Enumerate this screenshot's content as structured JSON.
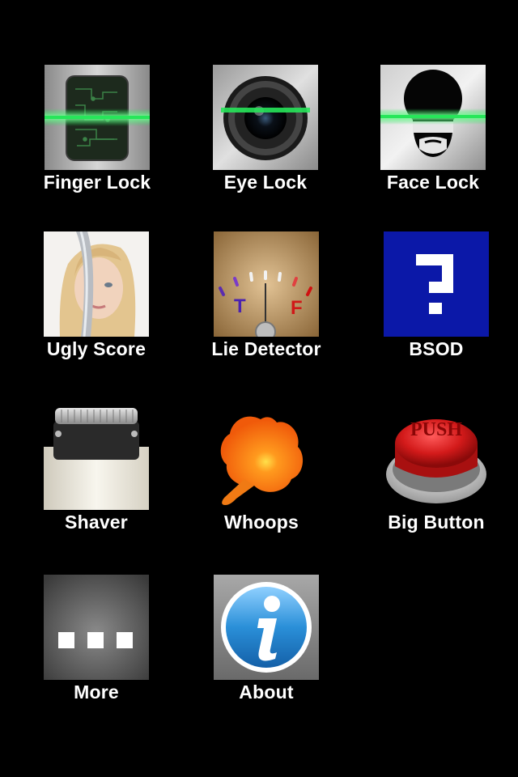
{
  "apps": [
    {
      "label": "Finger Lock",
      "icon": "fingerprint-scanner-icon"
    },
    {
      "label": "Eye Lock",
      "icon": "camera-lens-icon"
    },
    {
      "label": "Face Lock",
      "icon": "face-scan-icon"
    },
    {
      "label": "Ugly Score",
      "icon": "face-photo-icon"
    },
    {
      "label": "Lie Detector",
      "icon": "gauge-meter-icon"
    },
    {
      "label": "BSOD",
      "icon": "question-mark-icon"
    },
    {
      "label": "Shaver",
      "icon": "electric-shaver-icon"
    },
    {
      "label": "Whoops",
      "icon": "whoopee-cushion-icon"
    },
    {
      "label": "Big Button",
      "icon": "push-button-icon"
    },
    {
      "label": "More",
      "icon": "more-dots-icon"
    },
    {
      "label": "About",
      "icon": "info-icon"
    }
  ],
  "icon_text": {
    "gauge_true": "T",
    "gauge_false": "F",
    "push": "PUSH"
  },
  "colors": {
    "background": "#000000",
    "scan_line": "#27e65a",
    "bsod_blue": "#0b18a8",
    "button_red": "#d31a1a",
    "info_blue": "#2a8fd8"
  }
}
